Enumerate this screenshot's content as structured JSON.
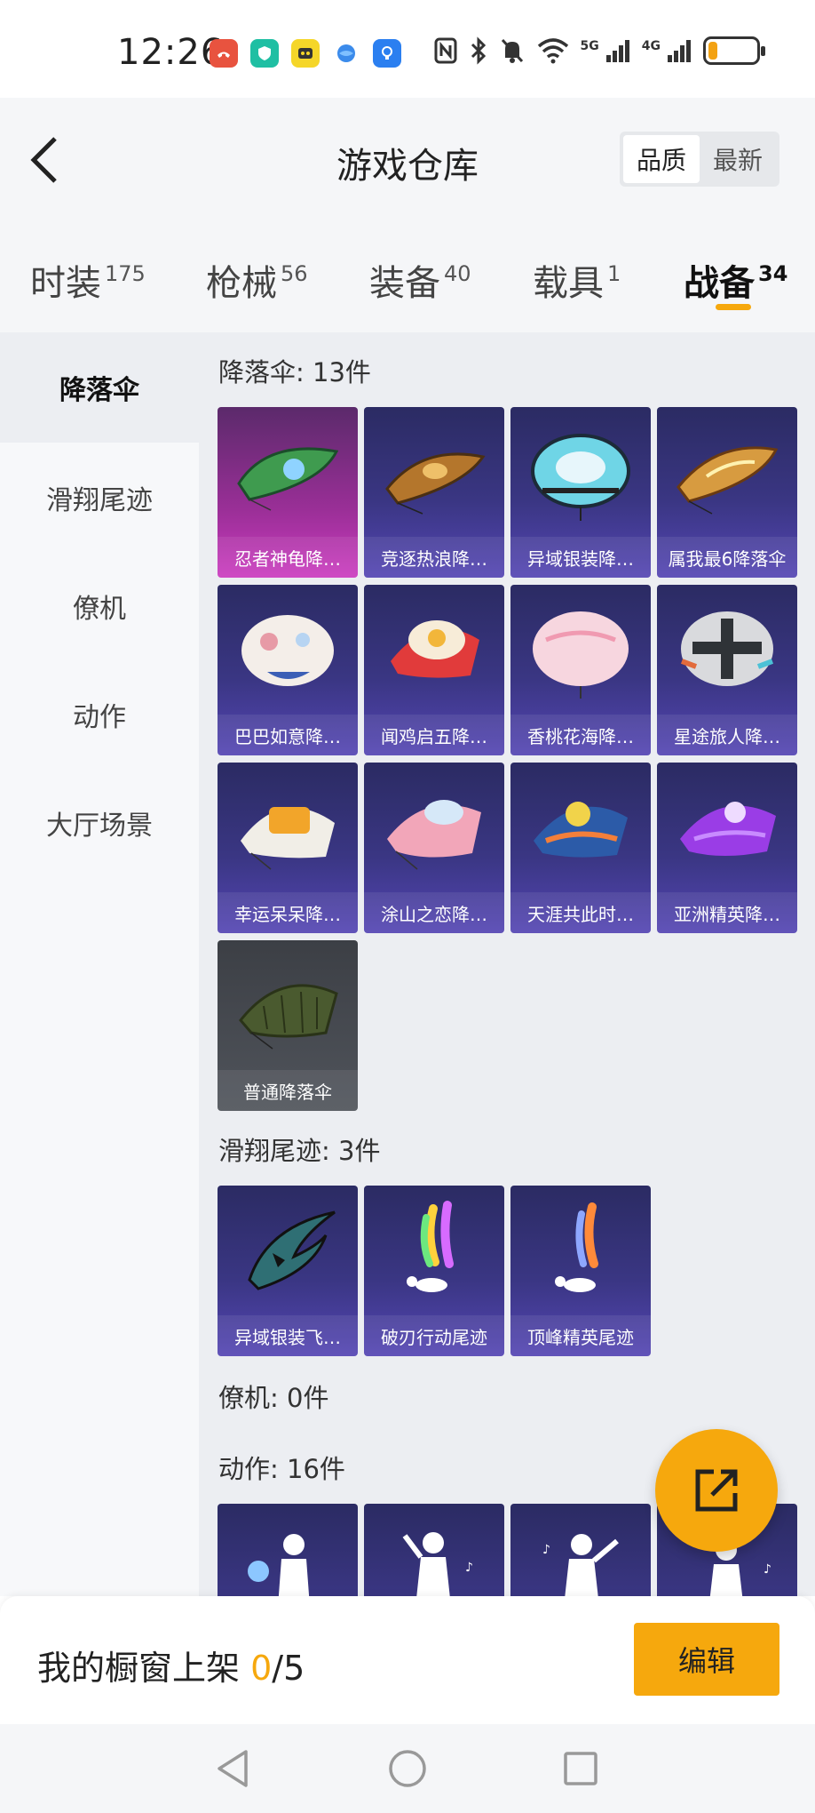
{
  "status_bar": {
    "time": "12:26",
    "sig1": "5G",
    "sig2": "4G",
    "battery_level": 0.2
  },
  "header": {
    "title": "游戏仓库",
    "sort_quality": "品质",
    "sort_newest": "最新"
  },
  "tabs": [
    {
      "label": "时装",
      "count": "175"
    },
    {
      "label": "枪械",
      "count": "56"
    },
    {
      "label": "装备",
      "count": "40"
    },
    {
      "label": "载具",
      "count": "1"
    },
    {
      "label": "战备",
      "count": "34"
    }
  ],
  "sidebar": {
    "items": [
      {
        "label": "降落伞"
      },
      {
        "label": "滑翔尾迹"
      },
      {
        "label": "僚机"
      },
      {
        "label": "动作"
      },
      {
        "label": "大厅场景"
      }
    ]
  },
  "sections": {
    "parachute": {
      "title": "降落伞: 13件",
      "items": [
        {
          "name": "忍者神龟降…"
        },
        {
          "name": "竞逐热浪降…"
        },
        {
          "name": "异域银装降…"
        },
        {
          "name": "属我最6降落伞"
        },
        {
          "name": "巴巴如意降…"
        },
        {
          "name": "闻鸡启五降…"
        },
        {
          "name": "香桃花海降…"
        },
        {
          "name": "星途旅人降…"
        },
        {
          "name": "幸运呆呆降…"
        },
        {
          "name": "涂山之恋降…"
        },
        {
          "name": "天涯共此时…"
        },
        {
          "name": "亚洲精英降…"
        },
        {
          "name": "普通降落伞"
        }
      ]
    },
    "glide_trail": {
      "title": "滑翔尾迹: 3件",
      "items": [
        {
          "name": "异域银装飞…"
        },
        {
          "name": "破刃行动尾迹"
        },
        {
          "name": "顶峰精英尾迹"
        }
      ]
    },
    "wingman": {
      "title": "僚机: 0件"
    },
    "emote": {
      "title": "动作: 16件"
    }
  },
  "bottom_bar": {
    "shelf_label": "我的橱窗上架 ",
    "shelf_current": "0",
    "shelf_total": "/5",
    "edit_label": "编辑"
  },
  "colors": {
    "accent": "#f6a80d",
    "card_purple": "#3a3683",
    "card_pink": "#cb3bbf",
    "card_gray": "#50545b"
  }
}
